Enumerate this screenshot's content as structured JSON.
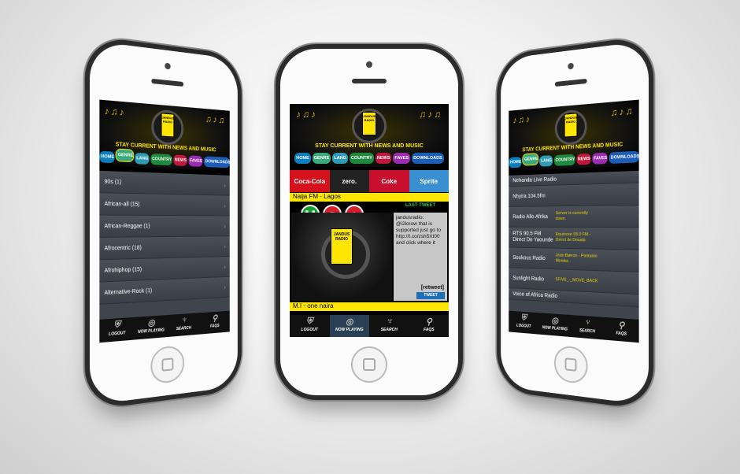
{
  "app": {
    "tagline": "STAY CURRENT WITH NEWS AND MUSIC",
    "logo_text": "JANDUS RADIO",
    "nav_tabs": [
      "HOME",
      "GENRE",
      "LANG",
      "COUNTRY",
      "NEWS",
      "FAVES",
      "DOWNLOADS"
    ],
    "tabbar": [
      "LOGOUT",
      "NOW PLAYING",
      "SEARCH",
      "FAQS"
    ]
  },
  "left_screen": {
    "active_tab": "GENRE",
    "genres": [
      "90s (1)",
      "African-all (15)",
      "African-Reggae (1)",
      "Afrocentric (18)",
      "Afrohiphop (15)",
      "Alternative-Rock (1)"
    ]
  },
  "center_screen": {
    "ads": [
      "Coca-Cola",
      "zero.",
      "Coke",
      "Sprite"
    ],
    "station": "Naija FM - Lagos",
    "last_tweet_label": "LAST TWEET",
    "tweet_text": "jandusradio: @i2know that is supported just go to http://t.co/zsh5XI00 and click where it",
    "retweet_label": "[retweet]",
    "tweet_button": "TWEET",
    "now_playing": "M.I - one naira",
    "active_tabbar": "NOW PLAYING"
  },
  "right_screen": {
    "active_tab": "GENRE",
    "stations": [
      {
        "name": "Nehanda Live Radio",
        "status": ""
      },
      {
        "name": "Nhyira 104.5fm",
        "status": ""
      },
      {
        "name": "Radio Allo Afrika",
        "status": "Server is currently down."
      },
      {
        "name": "RTS 90.5 FM Direct De Yaounde",
        "status": "Equinoxe 93.0 FM - Direct de Douala"
      },
      {
        "name": "Soukous Radio",
        "status": "Jean Bæron - Pantalon Monika"
      },
      {
        "name": "Sunlight Radio",
        "status": "5FIVE_-_MOVE_BACK"
      },
      {
        "name": "Voice of Africa Radio",
        "status": ""
      }
    ]
  }
}
